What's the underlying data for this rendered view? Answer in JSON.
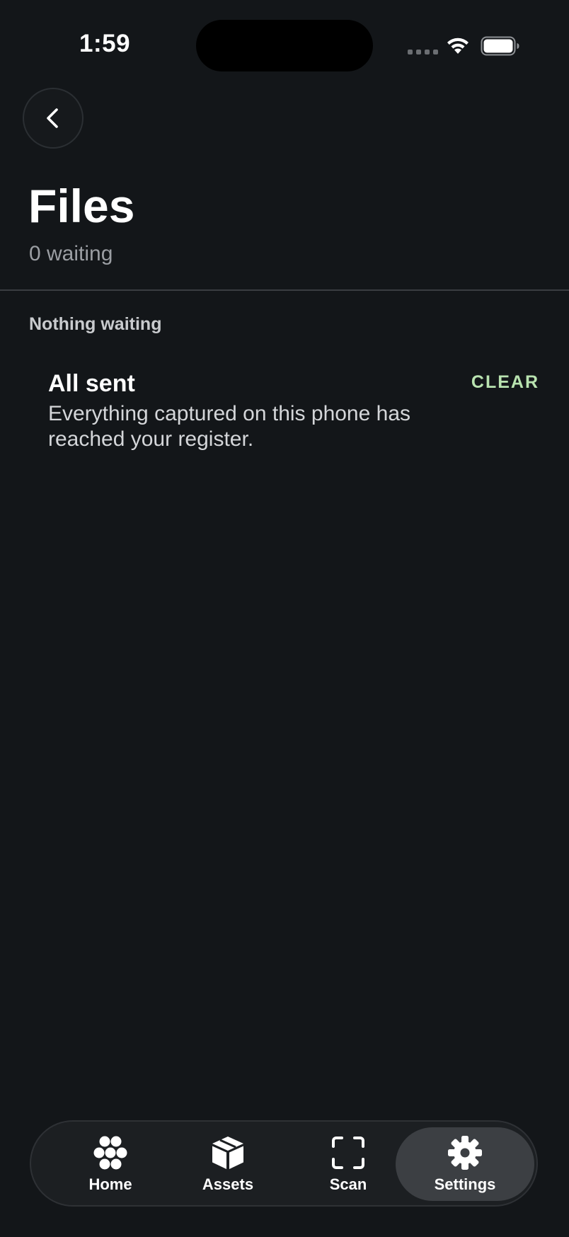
{
  "status_bar": {
    "time": "1:59"
  },
  "header": {
    "back_icon": "chevron-left-icon",
    "title": "Files",
    "subtitle": "0 waiting"
  },
  "section": {
    "heading": "Nothing waiting",
    "item": {
      "title": "All sent",
      "description": "Everything captured on this phone has reached your register.",
      "action_label": "CLEAR"
    }
  },
  "tab_bar": {
    "tabs": [
      {
        "label": "Home",
        "icon": "home-grid-icon",
        "active": false
      },
      {
        "label": "Assets",
        "icon": "box-icon",
        "active": false
      },
      {
        "label": "Scan",
        "icon": "scan-frame-icon",
        "active": false
      },
      {
        "label": "Settings",
        "icon": "gear-icon",
        "active": true
      }
    ]
  },
  "colors": {
    "background": "#131619",
    "accent": "#b9e3b0",
    "active_tab": "#3c3f43"
  }
}
